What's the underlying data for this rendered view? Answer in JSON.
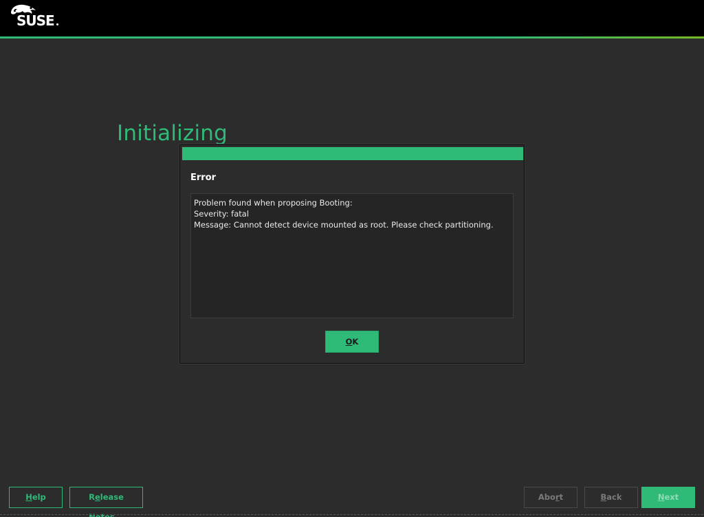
{
  "brand": {
    "logo_text": "SUSE",
    "accent_color": "#30ba78",
    "logo_icon": "chameleon-icon"
  },
  "page": {
    "title": "Initializing"
  },
  "dialog": {
    "heading": "Error",
    "message_lines": [
      "Problem found when proposing Booting:",
      "Severity: fatal",
      "Message: Cannot detect device mounted as root. Please check partitioning."
    ],
    "ok_label_accel": "O",
    "ok_label_rest": "K"
  },
  "footer": {
    "help_accel": "H",
    "help_rest": "elp",
    "release_notes_pre": "R",
    "release_notes_accel": "e",
    "release_notes_rest": "lease Notes...",
    "abort_pre": "Abo",
    "abort_accel": "r",
    "abort_rest": "t",
    "back_accel": "B",
    "back_rest": "ack",
    "next_accel": "N",
    "next_rest": "ext"
  }
}
